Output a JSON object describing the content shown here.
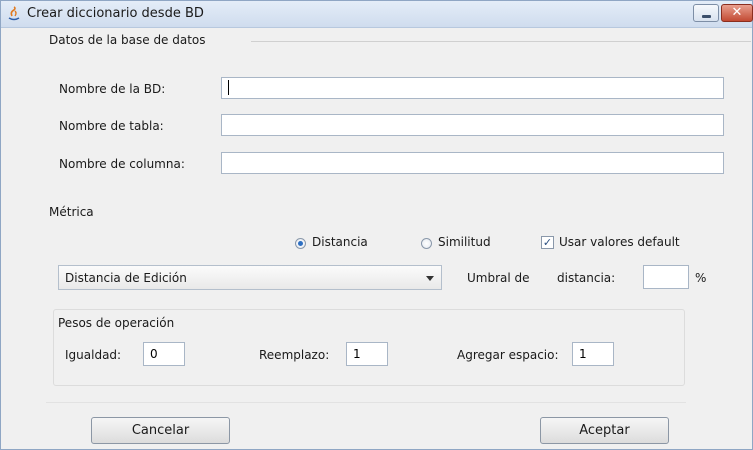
{
  "window": {
    "title": "Crear diccionario desde BD",
    "close_glyph": "✕"
  },
  "db_section": {
    "title": "Datos de la base de datos",
    "db_name_label": "Nombre de la BD:",
    "table_label": "Nombre de tabla:",
    "column_label": "Nombre de columna:",
    "db_name_value": "",
    "table_value": "",
    "column_value": ""
  },
  "metric": {
    "title": "Métrica",
    "distance_label": "Distancia",
    "similarity_label": "Similitud",
    "default_label": "Usar valores default",
    "distance_selected": true,
    "use_defaults_checked": true,
    "check_glyph": "✓",
    "algorithm_value": "Distancia de Edición",
    "threshold_label_1": "Umbral de",
    "threshold_label_2": "distancia:",
    "threshold_value": "",
    "percent": "%"
  },
  "weights": {
    "title": "Pesos de operación",
    "equality_label": "Igualdad:",
    "equality_value": "0",
    "replace_label": "Reemplazo:",
    "replace_value": "1",
    "space_label": "Agregar espacio:",
    "space_value": "1"
  },
  "buttons": {
    "cancel": "Cancelar",
    "accept": "Aceptar"
  },
  "colors": {
    "accent": "#2d6fc2",
    "close": "#c24a33"
  }
}
